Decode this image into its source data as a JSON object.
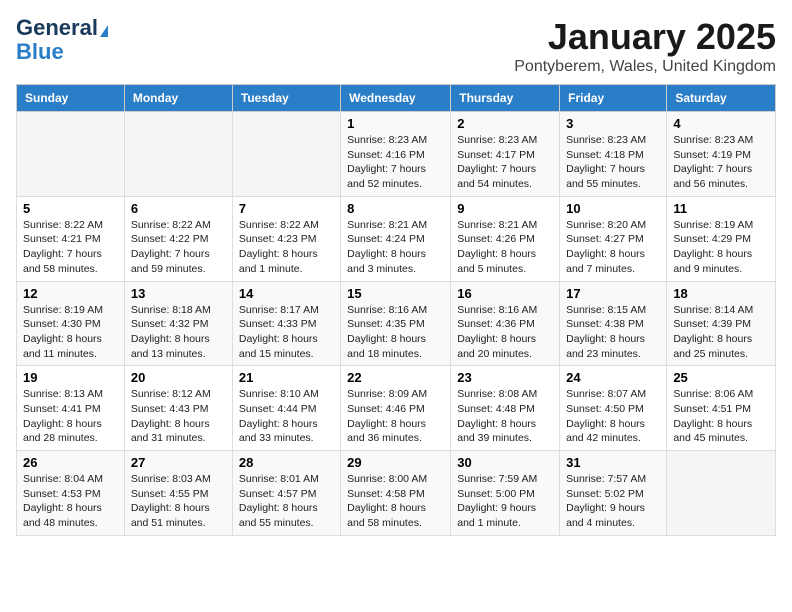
{
  "logo": {
    "general": "General",
    "blue": "Blue"
  },
  "title": "January 2025",
  "location": "Pontyberem, Wales, United Kingdom",
  "weekdays": [
    "Sunday",
    "Monday",
    "Tuesday",
    "Wednesday",
    "Thursday",
    "Friday",
    "Saturday"
  ],
  "weeks": [
    [
      {
        "day": "",
        "info": ""
      },
      {
        "day": "",
        "info": ""
      },
      {
        "day": "",
        "info": ""
      },
      {
        "day": "1",
        "info": "Sunrise: 8:23 AM\nSunset: 4:16 PM\nDaylight: 7 hours\nand 52 minutes."
      },
      {
        "day": "2",
        "info": "Sunrise: 8:23 AM\nSunset: 4:17 PM\nDaylight: 7 hours\nand 54 minutes."
      },
      {
        "day": "3",
        "info": "Sunrise: 8:23 AM\nSunset: 4:18 PM\nDaylight: 7 hours\nand 55 minutes."
      },
      {
        "day": "4",
        "info": "Sunrise: 8:23 AM\nSunset: 4:19 PM\nDaylight: 7 hours\nand 56 minutes."
      }
    ],
    [
      {
        "day": "5",
        "info": "Sunrise: 8:22 AM\nSunset: 4:21 PM\nDaylight: 7 hours\nand 58 minutes."
      },
      {
        "day": "6",
        "info": "Sunrise: 8:22 AM\nSunset: 4:22 PM\nDaylight: 7 hours\nand 59 minutes."
      },
      {
        "day": "7",
        "info": "Sunrise: 8:22 AM\nSunset: 4:23 PM\nDaylight: 8 hours\nand 1 minute."
      },
      {
        "day": "8",
        "info": "Sunrise: 8:21 AM\nSunset: 4:24 PM\nDaylight: 8 hours\nand 3 minutes."
      },
      {
        "day": "9",
        "info": "Sunrise: 8:21 AM\nSunset: 4:26 PM\nDaylight: 8 hours\nand 5 minutes."
      },
      {
        "day": "10",
        "info": "Sunrise: 8:20 AM\nSunset: 4:27 PM\nDaylight: 8 hours\nand 7 minutes."
      },
      {
        "day": "11",
        "info": "Sunrise: 8:19 AM\nSunset: 4:29 PM\nDaylight: 8 hours\nand 9 minutes."
      }
    ],
    [
      {
        "day": "12",
        "info": "Sunrise: 8:19 AM\nSunset: 4:30 PM\nDaylight: 8 hours\nand 11 minutes."
      },
      {
        "day": "13",
        "info": "Sunrise: 8:18 AM\nSunset: 4:32 PM\nDaylight: 8 hours\nand 13 minutes."
      },
      {
        "day": "14",
        "info": "Sunrise: 8:17 AM\nSunset: 4:33 PM\nDaylight: 8 hours\nand 15 minutes."
      },
      {
        "day": "15",
        "info": "Sunrise: 8:16 AM\nSunset: 4:35 PM\nDaylight: 8 hours\nand 18 minutes."
      },
      {
        "day": "16",
        "info": "Sunrise: 8:16 AM\nSunset: 4:36 PM\nDaylight: 8 hours\nand 20 minutes."
      },
      {
        "day": "17",
        "info": "Sunrise: 8:15 AM\nSunset: 4:38 PM\nDaylight: 8 hours\nand 23 minutes."
      },
      {
        "day": "18",
        "info": "Sunrise: 8:14 AM\nSunset: 4:39 PM\nDaylight: 8 hours\nand 25 minutes."
      }
    ],
    [
      {
        "day": "19",
        "info": "Sunrise: 8:13 AM\nSunset: 4:41 PM\nDaylight: 8 hours\nand 28 minutes."
      },
      {
        "day": "20",
        "info": "Sunrise: 8:12 AM\nSunset: 4:43 PM\nDaylight: 8 hours\nand 31 minutes."
      },
      {
        "day": "21",
        "info": "Sunrise: 8:10 AM\nSunset: 4:44 PM\nDaylight: 8 hours\nand 33 minutes."
      },
      {
        "day": "22",
        "info": "Sunrise: 8:09 AM\nSunset: 4:46 PM\nDaylight: 8 hours\nand 36 minutes."
      },
      {
        "day": "23",
        "info": "Sunrise: 8:08 AM\nSunset: 4:48 PM\nDaylight: 8 hours\nand 39 minutes."
      },
      {
        "day": "24",
        "info": "Sunrise: 8:07 AM\nSunset: 4:50 PM\nDaylight: 8 hours\nand 42 minutes."
      },
      {
        "day": "25",
        "info": "Sunrise: 8:06 AM\nSunset: 4:51 PM\nDaylight: 8 hours\nand 45 minutes."
      }
    ],
    [
      {
        "day": "26",
        "info": "Sunrise: 8:04 AM\nSunset: 4:53 PM\nDaylight: 8 hours\nand 48 minutes."
      },
      {
        "day": "27",
        "info": "Sunrise: 8:03 AM\nSunset: 4:55 PM\nDaylight: 8 hours\nand 51 minutes."
      },
      {
        "day": "28",
        "info": "Sunrise: 8:01 AM\nSunset: 4:57 PM\nDaylight: 8 hours\nand 55 minutes."
      },
      {
        "day": "29",
        "info": "Sunrise: 8:00 AM\nSunset: 4:58 PM\nDaylight: 8 hours\nand 58 minutes."
      },
      {
        "day": "30",
        "info": "Sunrise: 7:59 AM\nSunset: 5:00 PM\nDaylight: 9 hours\nand 1 minute."
      },
      {
        "day": "31",
        "info": "Sunrise: 7:57 AM\nSunset: 5:02 PM\nDaylight: 9 hours\nand 4 minutes."
      },
      {
        "day": "",
        "info": ""
      }
    ]
  ]
}
